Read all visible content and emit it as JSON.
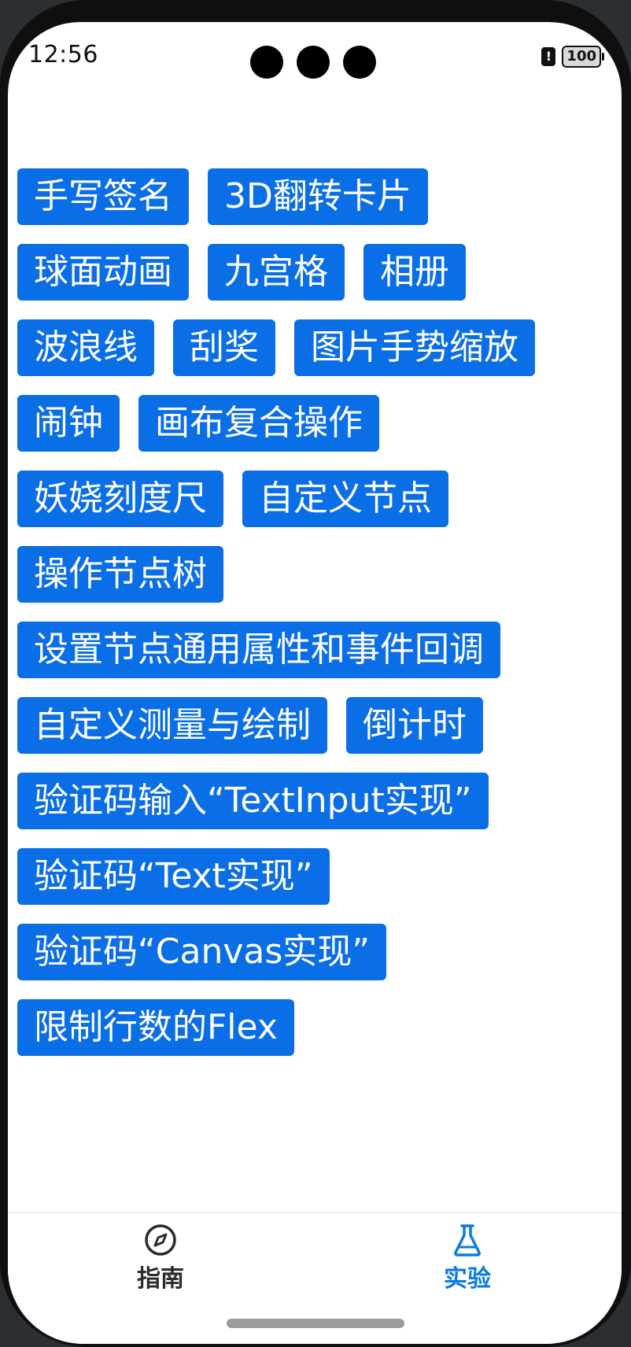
{
  "status_bar": {
    "time": "12:56",
    "battery": "100",
    "alert_icon": "exclamation-icon"
  },
  "buttons": {
    "rows": [
      [
        "手写签名",
        "3D翻转卡片"
      ],
      [
        "球面动画",
        "九宫格",
        "相册"
      ],
      [
        "波浪线",
        "刮奖",
        "图片手势缩放"
      ],
      [
        "闹钟",
        "画布复合操作"
      ],
      [
        "妖娆刻度尺",
        "自定义节点"
      ],
      [
        "操作节点树"
      ],
      [
        "设置节点通用属性和事件回调"
      ],
      [
        "自定义测量与绘制",
        "倒计时"
      ],
      [
        "验证码输入“TextInput实现”"
      ],
      [
        "验证码“Text实现”"
      ],
      [
        "验证码“Canvas实现”"
      ],
      [
        "限制行数的Flex"
      ]
    ],
    "color": "#0a6ee6"
  },
  "tabbar": {
    "tabs": [
      {
        "label": "指南",
        "icon": "compass-icon",
        "active": false
      },
      {
        "label": "实验",
        "icon": "flask-icon",
        "active": true
      }
    ],
    "active_color": "#0a7be0",
    "inactive_color": "#2b2b2b"
  }
}
